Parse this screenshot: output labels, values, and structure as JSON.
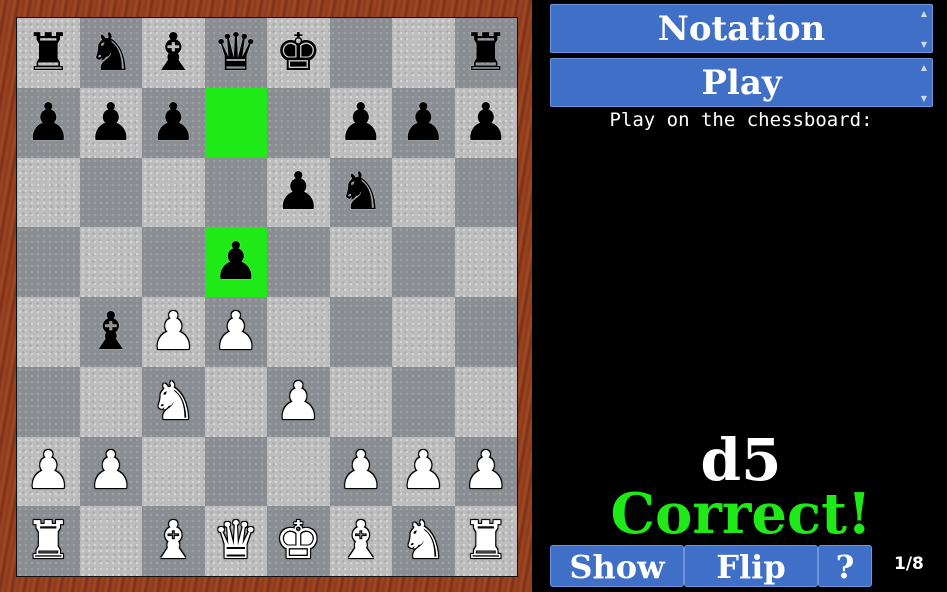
{
  "board": {
    "rows": [
      [
        "br",
        "bn",
        "bb",
        "bq",
        "bk",
        "",
        "",
        "br"
      ],
      [
        "bp",
        "bp",
        "bp",
        "",
        "",
        "bp",
        "bp",
        "bp"
      ],
      [
        "",
        "",
        "",
        "",
        "bp",
        "bn",
        "",
        ""
      ],
      [
        "",
        "",
        "",
        "bp",
        "",
        "",
        "",
        ""
      ],
      [
        "",
        "bb",
        "wp",
        "wp",
        "",
        "",
        "",
        ""
      ],
      [
        "",
        "",
        "wn",
        "",
        "wp",
        "",
        "",
        ""
      ],
      [
        "wp",
        "wp",
        "",
        "",
        "",
        "wp",
        "wp",
        "wp"
      ],
      [
        "wr",
        "",
        "wb",
        "wq",
        "wk",
        "wb",
        "wn",
        "wr"
      ]
    ],
    "highlighted": [
      "d7",
      "d5"
    ]
  },
  "panel": {
    "notation_label": "Notation",
    "play_label": "Play",
    "hint": "Play on the chessboard:",
    "move": "d5",
    "result": "Correct!",
    "show_label": "Show",
    "flip_label": "Flip",
    "help_label": "?",
    "counter": "1/8"
  }
}
